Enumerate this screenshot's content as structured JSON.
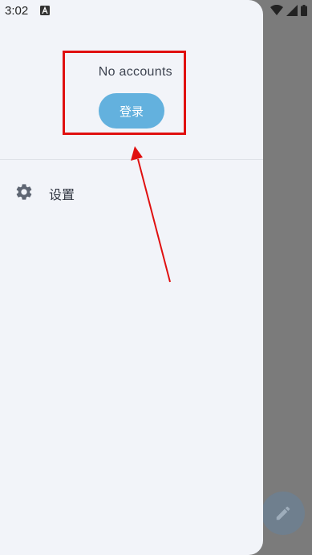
{
  "status_bar": {
    "time": "3:02",
    "notification_icon": "a-letter-notification-icon",
    "wifi_icon": "wifi-icon",
    "signal_icon": "cell-signal-icon",
    "battery_icon": "battery-icon"
  },
  "drawer": {
    "no_accounts_text": "No accounts",
    "login_label": "登录",
    "menu": [
      {
        "label": "设置",
        "icon": "gear-icon"
      }
    ]
  },
  "fab": {
    "icon": "pencil-icon"
  },
  "annotation": {
    "highlight_color": "#e01010",
    "arrow_color": "#e01010"
  },
  "colors": {
    "drawer_bg": "#f2f4f9",
    "login_button": "#63b1de",
    "scrim": "#7b7b7b"
  }
}
